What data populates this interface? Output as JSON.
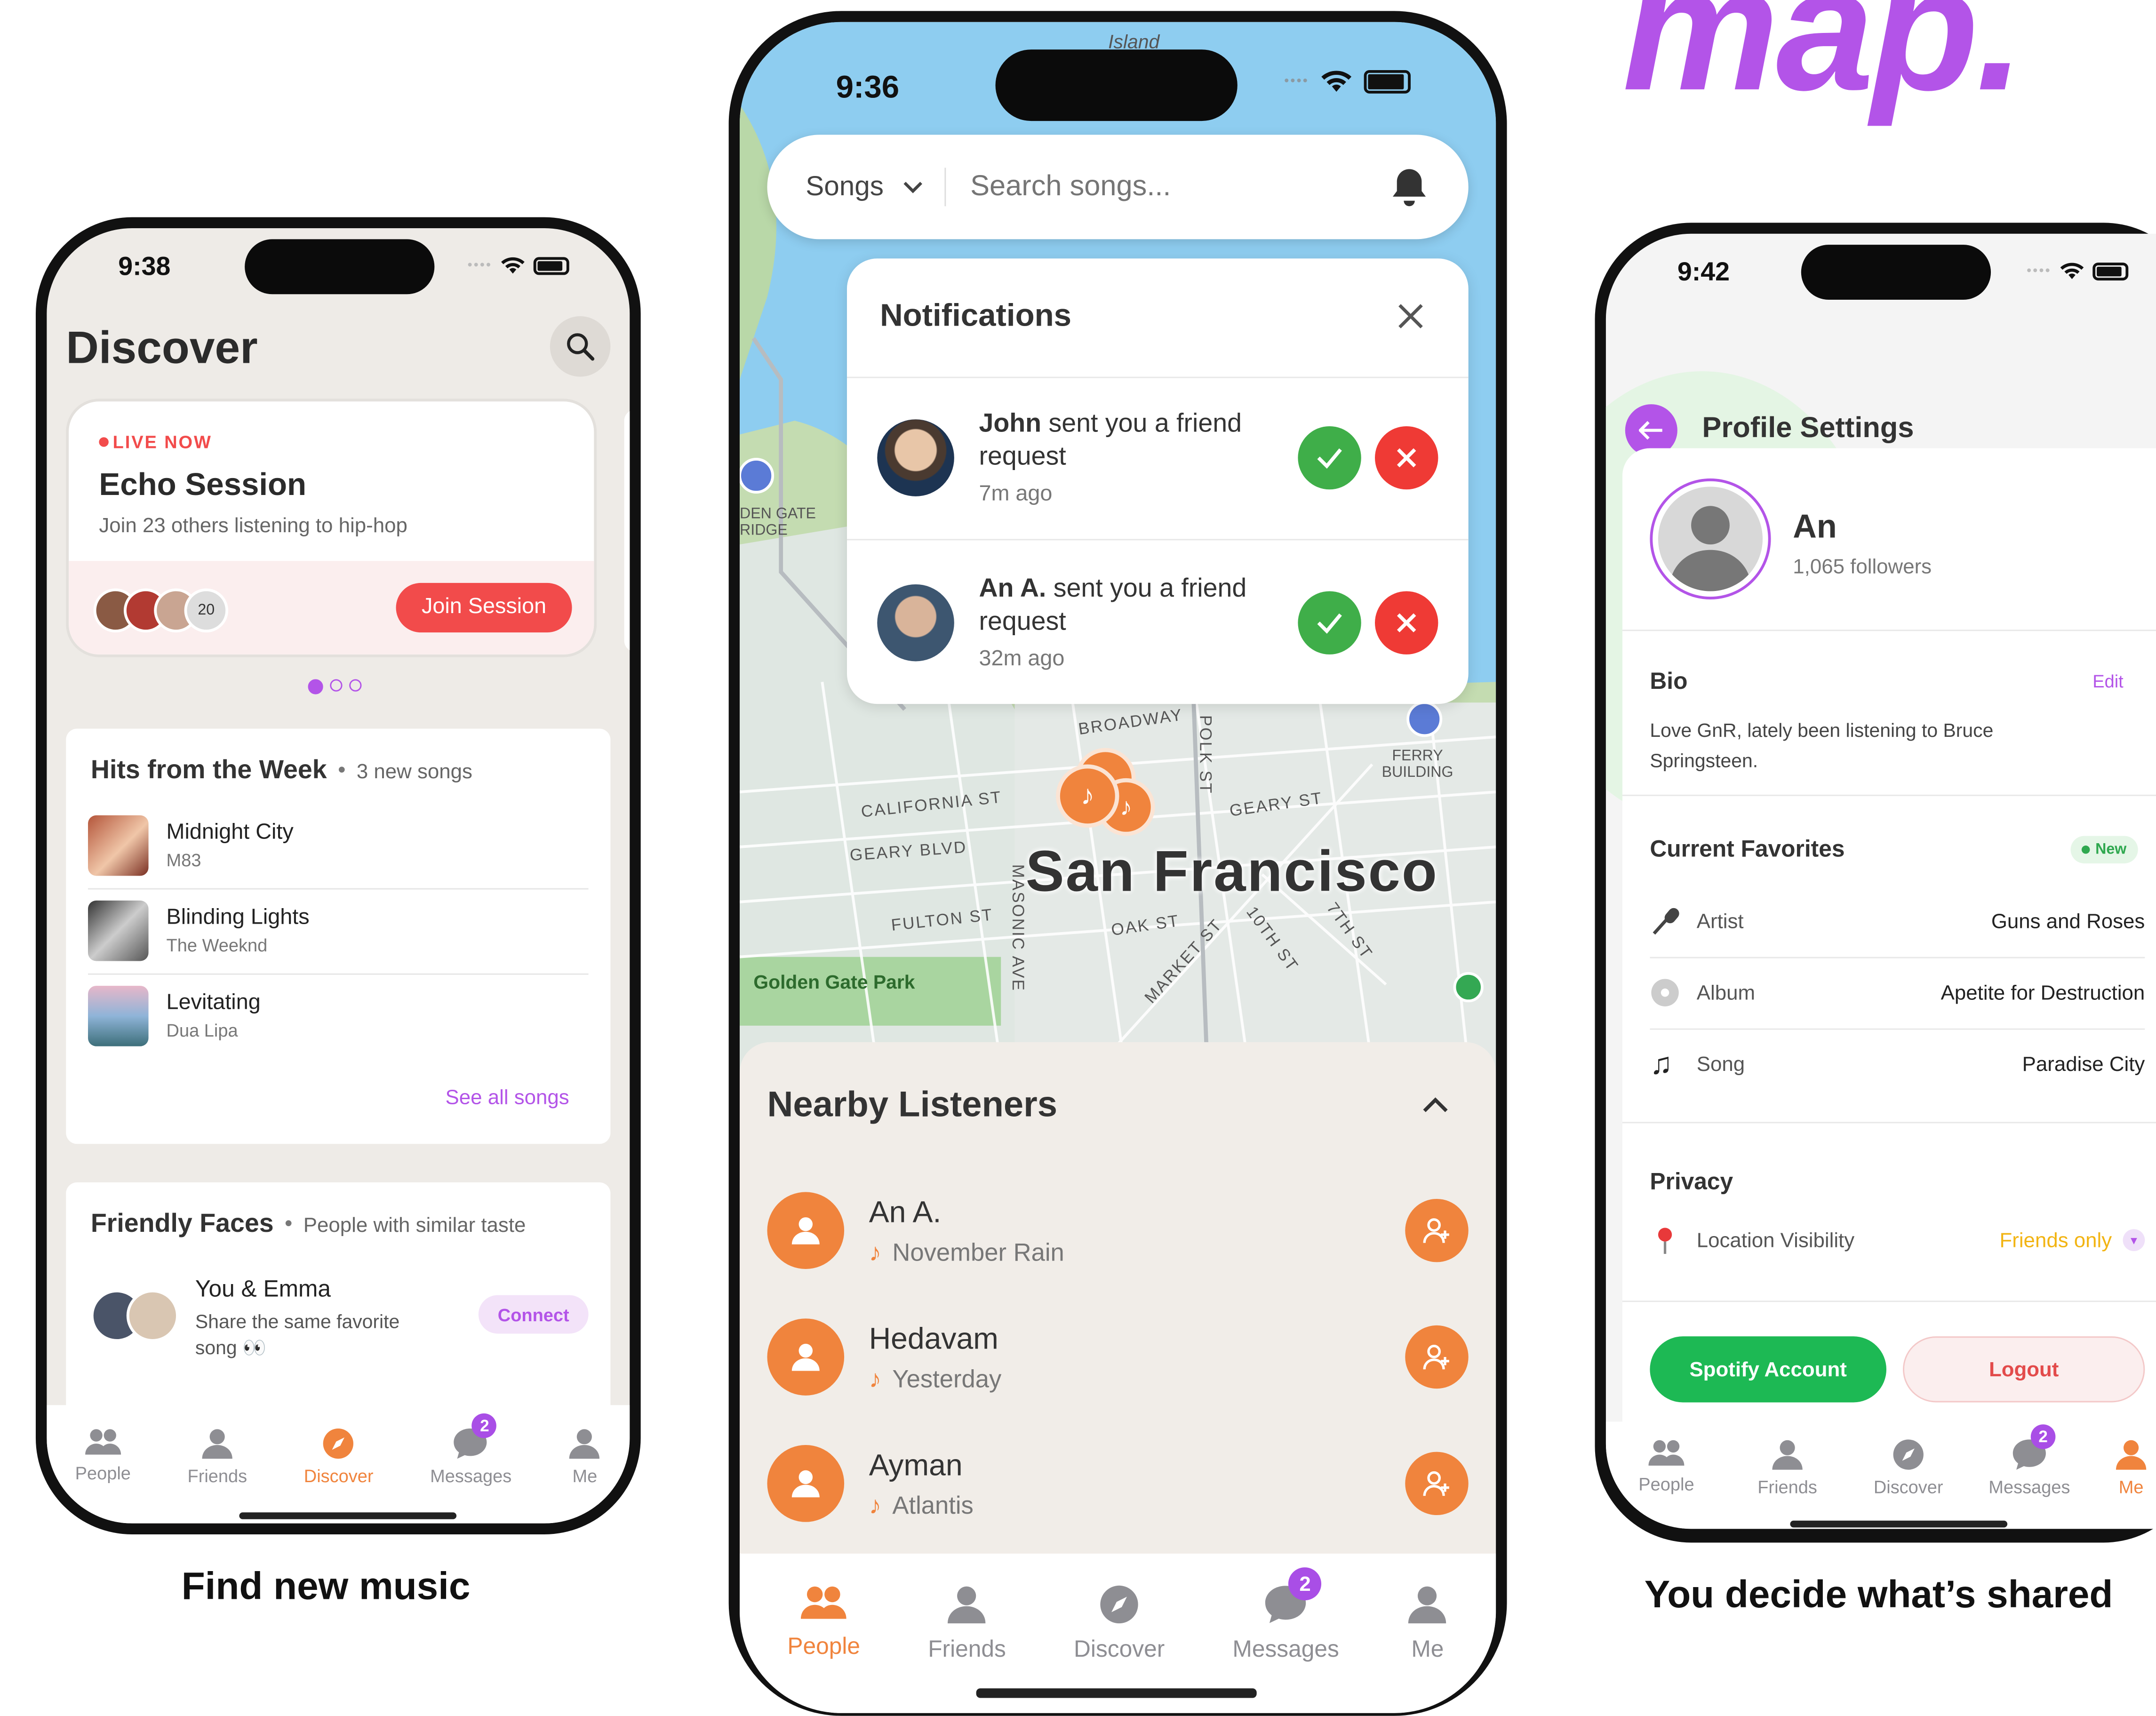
{
  "brand_fragment": "map.",
  "captions": {
    "left": "Find new music",
    "right": "You decide what’s shared"
  },
  "tabs": [
    "People",
    "Friends",
    "Discover",
    "Messages",
    "Me"
  ],
  "messages_badge": "2",
  "colors": {
    "accent_orange": "#f0843d",
    "accent_purple": "#a94ee6",
    "live_red": "#f24b4b",
    "accept_green": "#3fae49",
    "decline_red": "#ef3a35",
    "spotify_green": "#1db954"
  },
  "phone1": {
    "time": "9:38",
    "title": "Discover",
    "live": {
      "badge": "LIVE NOW",
      "title": "Echo Session",
      "subtitle": "Join 23 others listening to hip-hop",
      "avatar_count": "20",
      "join_button": "Join Session"
    },
    "hits": {
      "title": "Hits from the Week",
      "meta": "3 new songs",
      "songs": [
        {
          "title": "Midnight City",
          "artist": "M83"
        },
        {
          "title": "Blinding Lights",
          "artist": "The Weeknd"
        },
        {
          "title": "Levitating",
          "artist": "Dua Lipa"
        }
      ],
      "see_all": "See all songs"
    },
    "faces": {
      "title": "Friendly Faces",
      "meta": "People with similar taste",
      "match_title": "You & Emma",
      "match_desc": "Share the same favorite song 👀",
      "connect": "Connect"
    }
  },
  "phone2": {
    "time": "9:36",
    "search": {
      "filter": "Songs",
      "placeholder": "Search songs..."
    },
    "notifications": {
      "title": "Notifications",
      "items": [
        {
          "name": "John",
          "text": " sent you a friend request",
          "time": "7m ago"
        },
        {
          "name": "An A.",
          "text": " sent you a friend request",
          "time": "32m ago"
        }
      ]
    },
    "map_labels": {
      "city": "San Francisco",
      "broadway": "BROADWAY",
      "california": "CALIFORNIA ST",
      "geary_blvd": "GEARY BLVD",
      "geary_st": "GEARY ST",
      "fulton": "FULTON ST",
      "oak": "OAK ST",
      "market": "MARKET ST",
      "polk": "POLK ST",
      "tenth": "10TH ST",
      "seventh": "7TH ST",
      "masonic": "MASONIC AVE",
      "ferry": "FERRY BUILDING",
      "golden_gate_park": "Golden Gate Park",
      "golden_gate_bridge": "DEN GATE RIDGE",
      "island": "Island"
    },
    "nearby": {
      "title": "Nearby Listeners",
      "people": [
        {
          "name": "An A.",
          "song": "November Rain"
        },
        {
          "name": "Hedavam",
          "song": "Yesterday"
        },
        {
          "name": "Ayman",
          "song": "Atlantis"
        }
      ]
    }
  },
  "phone3": {
    "time": "9:42",
    "title": "Profile Settings",
    "name": "An",
    "followers": "1,065 followers",
    "bio": {
      "title": "Bio",
      "edit": "Edit",
      "text": "Love GnR, lately been listening to Bruce Springsteen."
    },
    "favorites": {
      "title": "Current Favorites",
      "badge": "New",
      "items": [
        {
          "label": "Artist",
          "value": "Guns and Roses"
        },
        {
          "label": "Album",
          "value": "Apetite for Destruction"
        },
        {
          "label": "Song",
          "value": "Paradise City"
        }
      ]
    },
    "privacy": {
      "title": "Privacy",
      "label": "Location Visibility",
      "value": "Friends only"
    },
    "spotify_button": "Spotify Account",
    "logout_button": "Logout"
  }
}
